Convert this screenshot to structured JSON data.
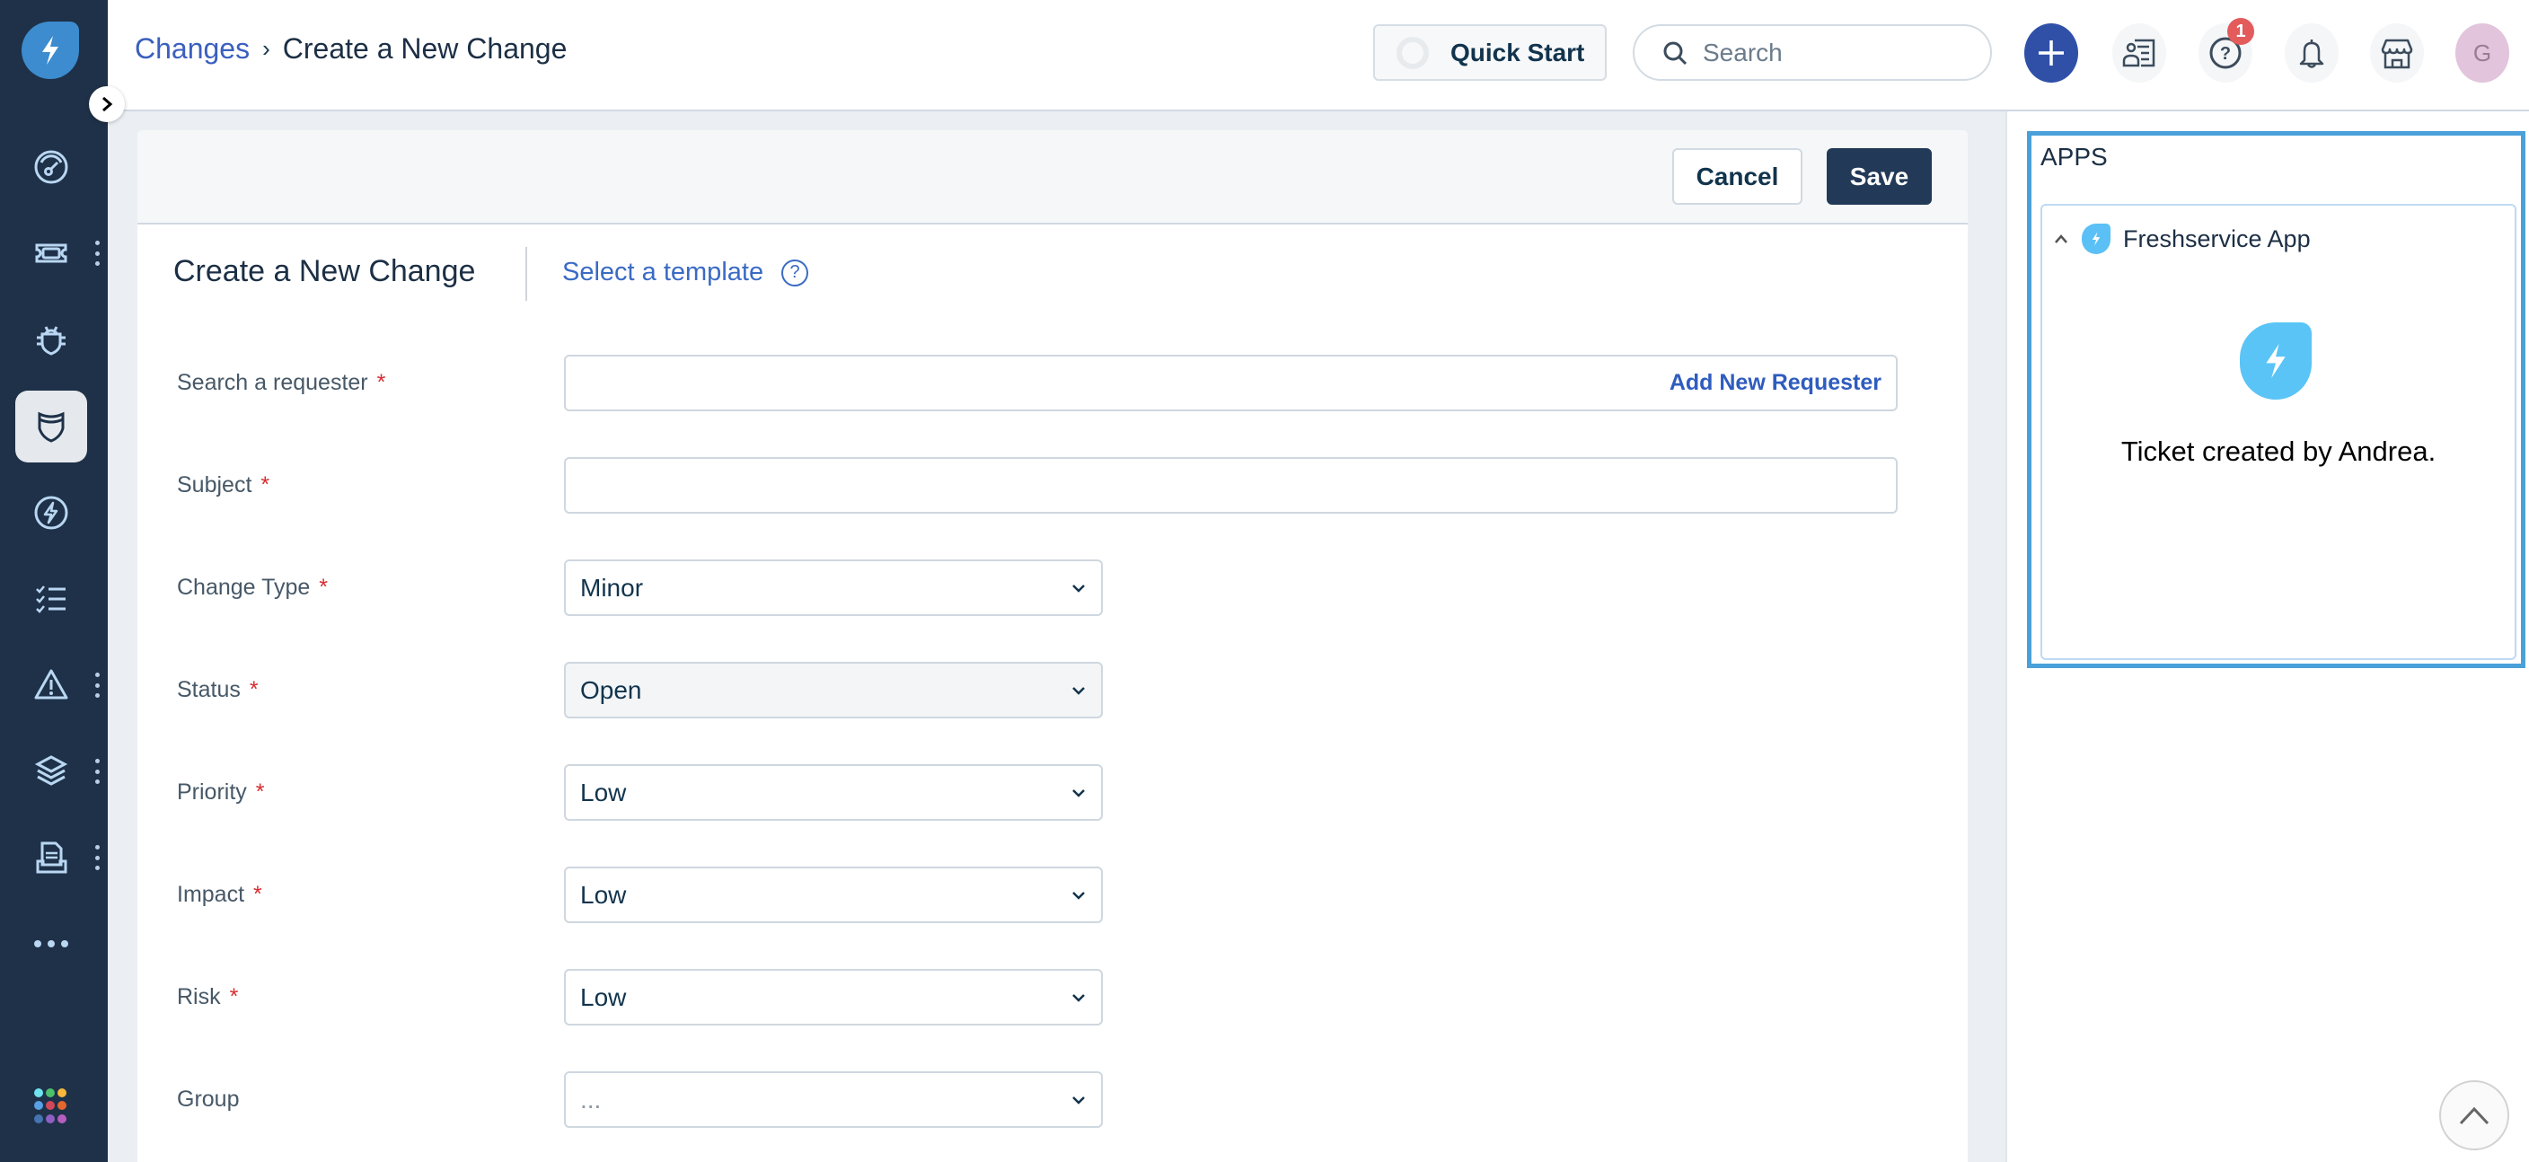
{
  "sidebar": {
    "items": [
      {
        "name": "dashboard",
        "icon": "dashboard-gauge-icon",
        "has_menu": false
      },
      {
        "name": "tickets",
        "icon": "ticket-icon",
        "has_menu": true
      },
      {
        "name": "problems",
        "icon": "bug-icon",
        "has_menu": false
      },
      {
        "name": "changes",
        "icon": "shield-icon",
        "has_menu": false,
        "active": true
      },
      {
        "name": "releases",
        "icon": "lightning-icon",
        "has_menu": false
      },
      {
        "name": "tasks",
        "icon": "checklist-icon",
        "has_menu": false
      },
      {
        "name": "alerts",
        "icon": "warning-icon",
        "has_menu": true
      },
      {
        "name": "assets",
        "icon": "layers-icon",
        "has_menu": true
      },
      {
        "name": "solutions",
        "icon": "document-tray-icon",
        "has_menu": true
      },
      {
        "name": "more",
        "icon": "more-horizontal-icon",
        "has_menu": false
      }
    ],
    "apps_grid_colors": [
      "#6fe4f0",
      "#4cc06d",
      "#f6b73c",
      "#5aa0e6",
      "#d2475a",
      "#e4672e",
      "#4674b0",
      "#8f5fc4",
      "#b65ec0"
    ]
  },
  "header": {
    "breadcrumb": {
      "parent": "Changes",
      "separator": "›",
      "current": "Create a New Change"
    },
    "quick_start_label": "Quick Start",
    "search_placeholder": "Search",
    "help_badge_count": "1",
    "avatar_initial": "G"
  },
  "toolbar": {
    "cancel_label": "Cancel",
    "save_label": "Save"
  },
  "form": {
    "title": "Create a New Change",
    "template_link": "Select a template",
    "help_glyph": "?",
    "required_marker": "*",
    "fields": [
      {
        "label": "Search a requester",
        "required": true,
        "type": "text",
        "value": "",
        "action_link": "Add New Requester"
      },
      {
        "label": "Subject",
        "required": true,
        "type": "text",
        "value": ""
      },
      {
        "label": "Change Type",
        "required": true,
        "type": "select",
        "value": "Minor"
      },
      {
        "label": "Status",
        "required": true,
        "type": "select",
        "value": "Open",
        "disabled": true
      },
      {
        "label": "Priority",
        "required": true,
        "type": "select",
        "value": "Low"
      },
      {
        "label": "Impact",
        "required": true,
        "type": "select",
        "value": "Low"
      },
      {
        "label": "Risk",
        "required": true,
        "type": "select",
        "value": "Low"
      },
      {
        "label": "Group",
        "required": false,
        "type": "select",
        "value": "",
        "placeholder": "..."
      }
    ]
  },
  "apps_panel": {
    "title": "APPS",
    "app_name": "Freshservice App",
    "message": "Ticket created by Andrea."
  },
  "colors": {
    "sidebar_bg": "#1e3148",
    "brand_blue": "#3c8ccf",
    "primary_button": "#223a57",
    "link_blue": "#3a5fbf",
    "plus_button": "#3050a8",
    "badge_red": "#e35b5b",
    "apps_highlight": "#4aa0d8",
    "required_red": "#d72d30"
  }
}
